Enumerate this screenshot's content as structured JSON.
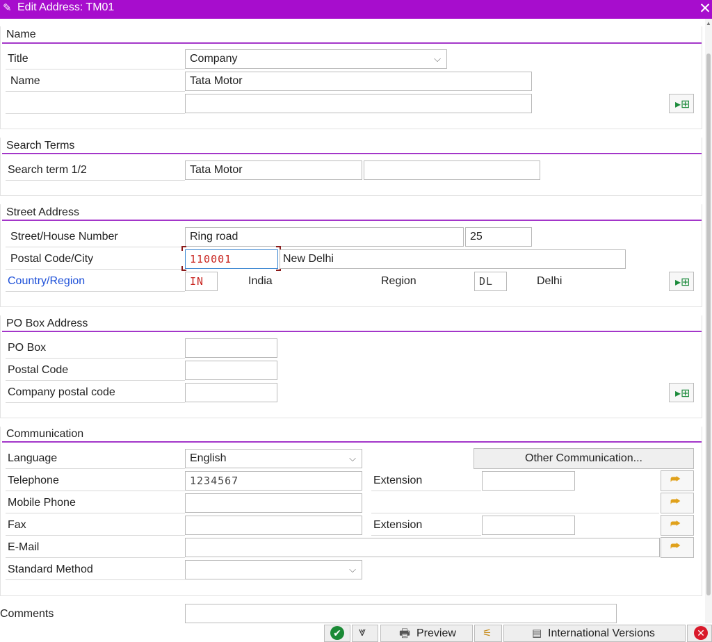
{
  "window": {
    "title": "Edit Address:  TM01",
    "close": "✕"
  },
  "name_section": {
    "heading": "Name",
    "title_label": "Title",
    "title_value": "Company",
    "name_label": "Name",
    "name_value": "Tata Motor",
    "name2_value": ""
  },
  "search_section": {
    "heading": "Search Terms",
    "label": "Search term 1/2",
    "term1": "Tata Motor",
    "term2": ""
  },
  "street_section": {
    "heading": "Street Address",
    "street_label": "Street/House Number",
    "street_value": "Ring road",
    "house_value": "25",
    "postal_label": "Postal Code/City",
    "postal_value": "110001",
    "city_value": "New Delhi",
    "country_label": "Country/Region",
    "country_code": "IN",
    "country_name": "India",
    "region_label": "Region",
    "region_code": "DL",
    "region_name": "Delhi"
  },
  "pobox_section": {
    "heading": "PO Box Address",
    "pobox_label": "PO Box",
    "postal_label": "Postal Code",
    "company_postal_label": "Company postal code"
  },
  "comm_section": {
    "heading": "Communication",
    "language_label": "Language",
    "language_value": "English",
    "other_button": "Other Communication...",
    "telephone_label": "Telephone",
    "telephone_value": "1234567",
    "extension_label": "Extension",
    "mobile_label": "Mobile Phone",
    "fax_label": "Fax",
    "fax_extension_label": "Extension",
    "email_label": "E-Mail",
    "standard_label": "Standard Method",
    "standard_value": ""
  },
  "comments": {
    "label": "Comments"
  },
  "footer": {
    "preview_label": "Preview",
    "intl_label": "International Versions"
  },
  "colors": {
    "titlebar": "#a70dcd",
    "section_rule": "#a336c9",
    "link": "#1c4fd8",
    "error_value": "#c8231e"
  }
}
